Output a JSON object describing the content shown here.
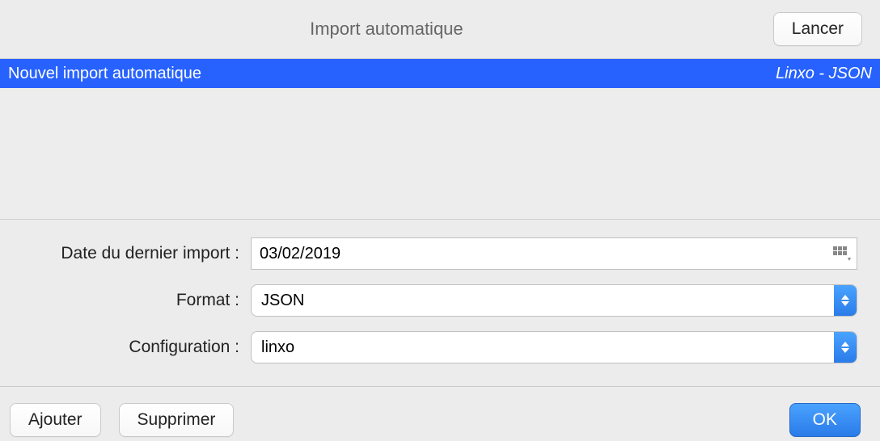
{
  "header": {
    "title": "Import automatique",
    "launch_label": "Lancer"
  },
  "list": {
    "selected": {
      "name": "Nouvel import automatique",
      "type": "Linxo - JSON"
    }
  },
  "form": {
    "date_label": "Date du dernier import :",
    "date_value": "03/02/2019",
    "format_label": "Format :",
    "format_value": "JSON",
    "config_label": "Configuration :",
    "config_value": "linxo"
  },
  "footer": {
    "add_label": "Ajouter",
    "delete_label": "Supprimer",
    "ok_label": "OK"
  }
}
